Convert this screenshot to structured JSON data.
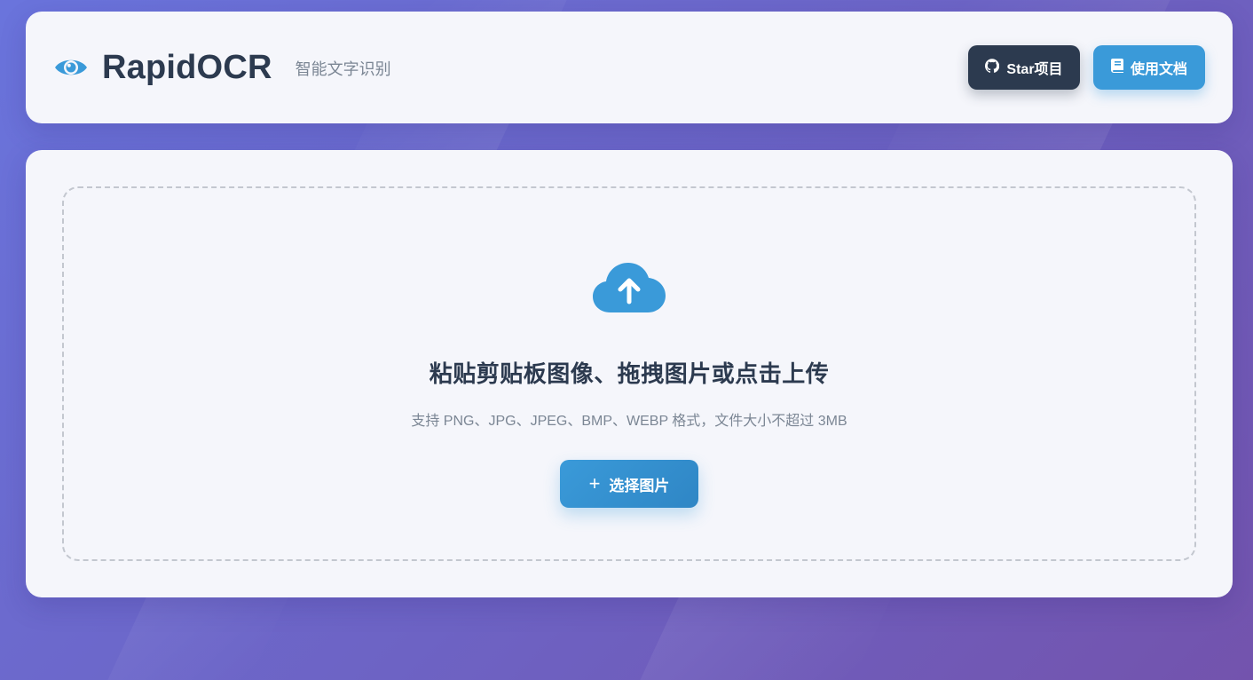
{
  "header": {
    "brand_icon": "eye-icon",
    "title": "RapidOCR",
    "subtitle": "智能文字识别",
    "star_button": {
      "icon": "github-icon",
      "label": "Star项目"
    },
    "docs_button": {
      "icon": "book-icon",
      "label": "使用文档"
    }
  },
  "upload": {
    "icon": "cloud-upload-icon",
    "title": "粘贴剪贴板图像、拖拽图片或点击上传",
    "hint": "支持 PNG、JPG、JPEG、BMP、WEBP 格式，文件大小不超过 3MB",
    "select_button": {
      "icon": "plus-icon",
      "label": "选择图片"
    }
  },
  "colors": {
    "accent": "#3a9ad9",
    "dark": "#2c3a4f",
    "muted": "#7b8694",
    "card": "#f5f6fb"
  }
}
